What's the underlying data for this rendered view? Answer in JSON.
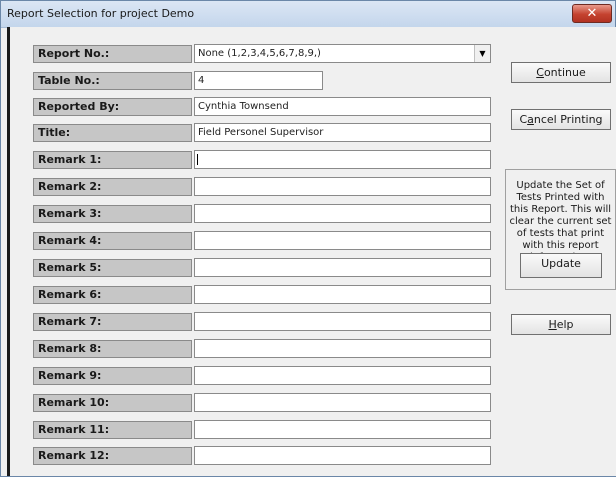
{
  "window": {
    "title": "Report Selection for project Demo",
    "close_glyph": "✕"
  },
  "form": {
    "report_no": {
      "label": "Report No.:",
      "value": "None (1,2,3,4,5,6,7,8,9,)"
    },
    "table_no": {
      "label": "Table No.:",
      "value": "4"
    },
    "reported_by": {
      "label": "Reported By:",
      "value": "Cynthia Townsend"
    },
    "title_field": {
      "label": "Title:",
      "value": "Field Personel Supervisor"
    },
    "remarks": [
      {
        "label": "Remark 1:",
        "value": ""
      },
      {
        "label": "Remark 2:",
        "value": ""
      },
      {
        "label": "Remark 3:",
        "value": ""
      },
      {
        "label": "Remark 4:",
        "value": ""
      },
      {
        "label": "Remark 5:",
        "value": ""
      },
      {
        "label": "Remark 6:",
        "value": ""
      },
      {
        "label": "Remark 7:",
        "value": ""
      },
      {
        "label": "Remark 8:",
        "value": ""
      },
      {
        "label": "Remark 9:",
        "value": ""
      },
      {
        "label": "Remark 10:",
        "value": ""
      },
      {
        "label": "Remark 11:",
        "value": ""
      },
      {
        "label": "Remark 12:",
        "value": ""
      }
    ]
  },
  "buttons": {
    "continue": {
      "mnemonic": "C",
      "rest": "ontinue"
    },
    "cancel_printing": {
      "pre": "C",
      "mnemonic": "a",
      "rest": "ncel Printing"
    },
    "help": {
      "mnemonic": "H",
      "rest": "elp"
    },
    "update": "Update"
  },
  "info": {
    "text": "Update the Set of Tests Printed with this Report.  This will clear the current set of tests that print with this report information."
  },
  "icons": {
    "dropdown": "chevron-down-icon",
    "close": "close-icon"
  },
  "colors": {
    "close_button": "#c4422f",
    "label_bg": "#c6c6c6",
    "titlebar": "#c4d6ec"
  }
}
